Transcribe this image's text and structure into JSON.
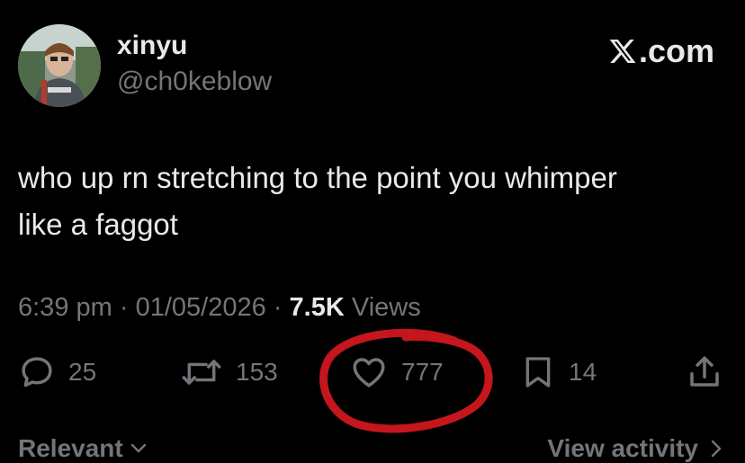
{
  "author": {
    "name": "xinyu",
    "handle": "@ch0keblow"
  },
  "brand": {
    "label": ".com"
  },
  "tweet": {
    "text_line1": "who up rn stretching to the point you whimper",
    "text_line2": "like a faggot"
  },
  "meta": {
    "time": "6:39 pm",
    "sep1": "·",
    "date": "01/05/2026",
    "sep2": "·",
    "views_count": "7.5K",
    "views_label": "Views"
  },
  "actions": {
    "replies": "25",
    "reposts": "153",
    "likes": "777",
    "bookmarks": "14"
  },
  "footer": {
    "sort_label": "Relevant",
    "view_activity": "View activity"
  },
  "colors": {
    "background": "#000000",
    "text": "#e7e9ea",
    "muted": "#71767b",
    "annotation": "#c4161c"
  }
}
